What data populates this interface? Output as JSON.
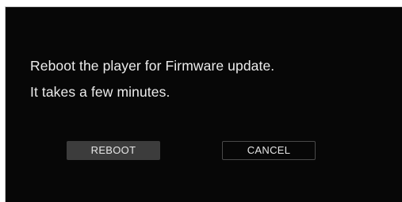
{
  "dialog": {
    "message_line1": "Reboot the player for Firmware update.",
    "message_line2": "It takes a few minutes.",
    "reboot_label": "REBOOT",
    "cancel_label": "CANCEL"
  },
  "colors": {
    "background": "#070707",
    "text": "#ececec",
    "reboot_button_bg": "#3c3c3c",
    "cancel_button_border": "#4a4a4a",
    "frame": "#c9c9c9"
  }
}
